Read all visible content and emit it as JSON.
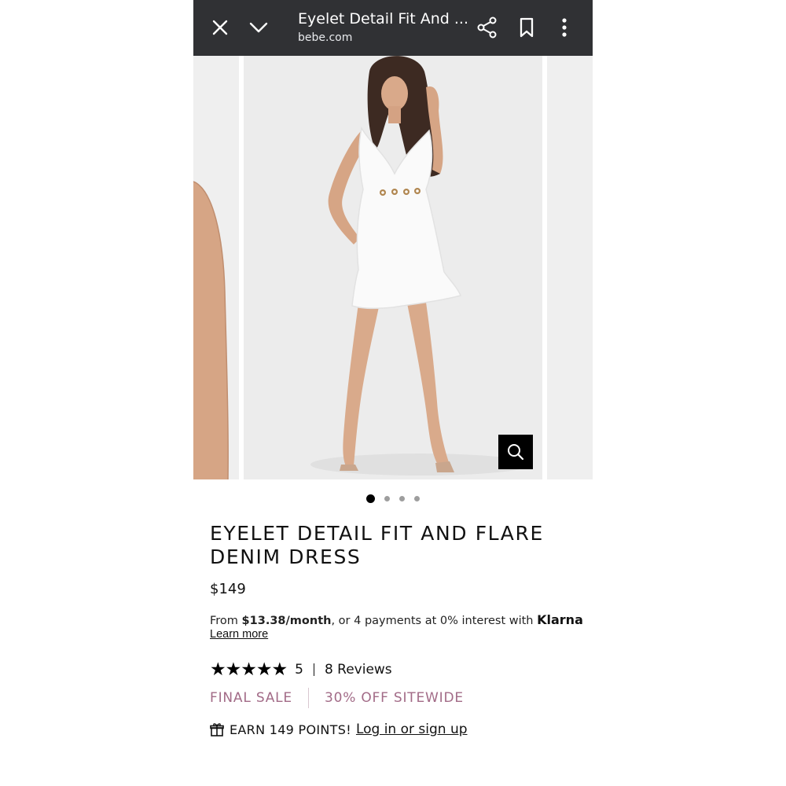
{
  "browser": {
    "title": "Eyelet Detail Fit And ...",
    "url": "bebe.com"
  },
  "product": {
    "title": "EYELET DETAIL FIT AND FLARE DENIM DRESS",
    "price": "$149",
    "financing": {
      "prefix": "From ",
      "amount": "$13.38/month",
      "suffix": ", or 4 payments at 0% interest with ",
      "provider": "Klarna",
      "learn_more": "Learn more"
    },
    "rating": {
      "stars": "★★★★★",
      "value": "5",
      "reviews": "8 Reviews"
    },
    "tags": {
      "sale": "FINAL SALE",
      "promo": "30% OFF SITEWIDE"
    },
    "points": {
      "label": "EARN 149 POINTS!",
      "login": "Log in or sign up"
    }
  },
  "carousel": {
    "image_count": 4,
    "active_index": 0
  },
  "colors": {
    "topbar": "#303134",
    "promo_text": "#a26b87"
  }
}
